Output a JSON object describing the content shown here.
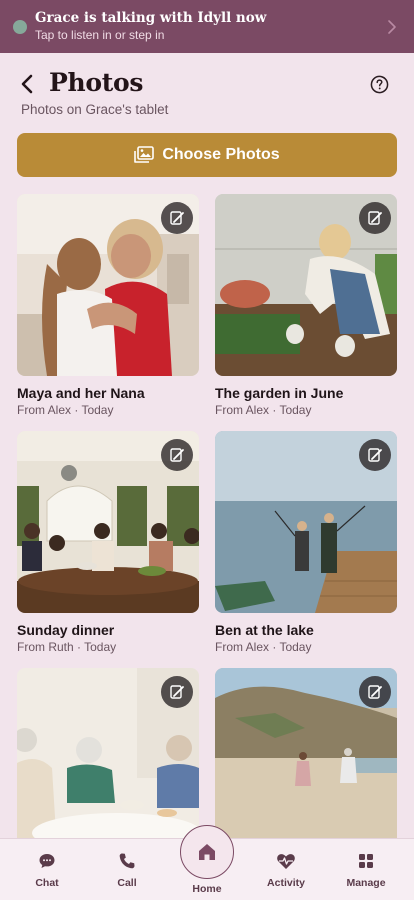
{
  "banner": {
    "title": "Grace is talking with Idyll now",
    "subtitle": "Tap to listen in or step in",
    "status_color": "#86a99a"
  },
  "header": {
    "title": "Photos",
    "subtitle": "Photos on Grace's tablet"
  },
  "choose_button": {
    "label": "Choose Photos",
    "icon": "photo-icon",
    "color": "#b98b37"
  },
  "photos": [
    {
      "title": "Maya and her Nana",
      "meta": "From Alex · Today",
      "badge_icon": "edit-icon"
    },
    {
      "title": "The garden in June",
      "meta": "From Alex · Today",
      "badge_icon": "edit-icon"
    },
    {
      "title": "Sunday dinner",
      "meta": "From Ruth · Today",
      "badge_icon": "edit-icon"
    },
    {
      "title": "Ben at the lake",
      "meta": "From Alex · Today",
      "badge_icon": "edit-icon"
    },
    {
      "title": "",
      "meta": "",
      "badge_icon": "edit-icon"
    },
    {
      "title": "",
      "meta": "",
      "badge_icon": "edit-icon"
    }
  ],
  "nav": {
    "items": [
      {
        "label": "Chat",
        "icon": "chat-icon"
      },
      {
        "label": "Call",
        "icon": "phone-icon"
      },
      {
        "label": "Home",
        "icon": "home-icon"
      },
      {
        "label": "Activity",
        "icon": "heart-pulse-icon"
      },
      {
        "label": "Manage",
        "icon": "grid-icon"
      }
    ]
  },
  "colors": {
    "accent": "#7b4a64",
    "background": "#f2e4ec",
    "gold": "#b98b37"
  }
}
